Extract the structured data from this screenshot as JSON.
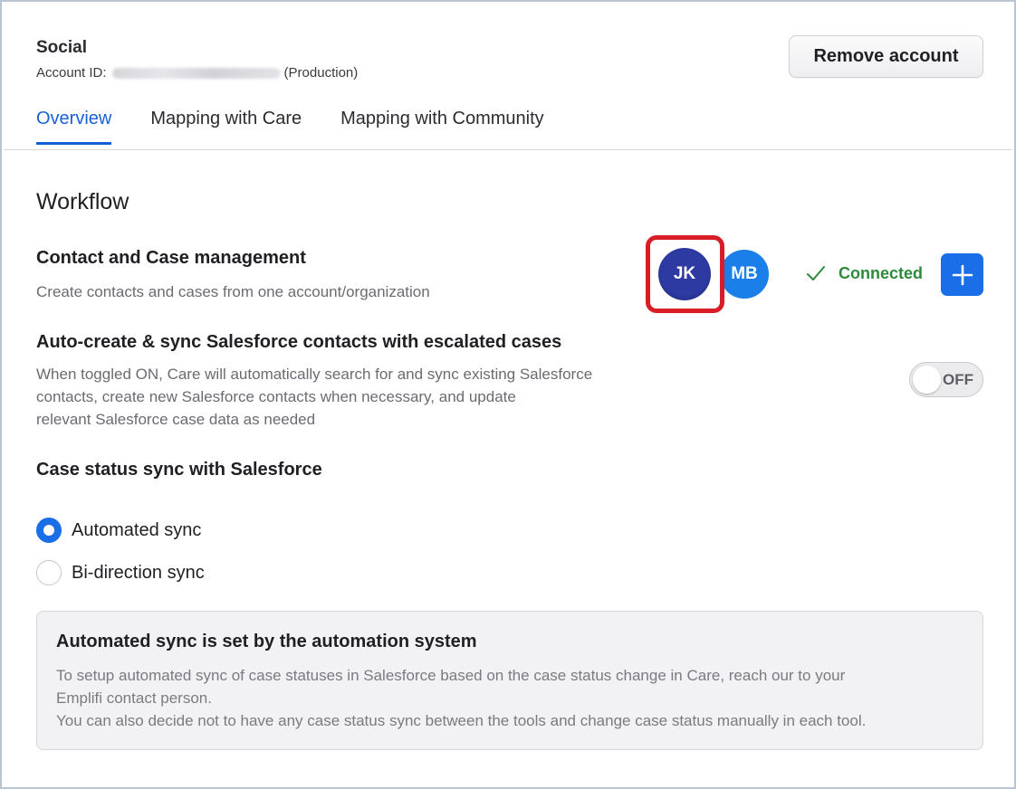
{
  "account": {
    "title": "Social",
    "id_label": "Account ID:",
    "environment": "(Production)",
    "remove_label": "Remove account"
  },
  "tabs": [
    {
      "label": "Overview",
      "active": true
    },
    {
      "label": "Mapping with Care",
      "active": false
    },
    {
      "label": "Mapping with Community",
      "active": false
    }
  ],
  "workflow": {
    "title": "Workflow",
    "contact_case": {
      "title": "Contact and Case management",
      "description": "Create contacts and cases from one account/organization",
      "avatars": [
        {
          "initials": "JK",
          "color": "#2d3aa2"
        },
        {
          "initials": "MB",
          "color": "#1a7fe8"
        }
      ],
      "status": "Connected",
      "status_color": "#2d8a3a",
      "add_icon": "plus-icon"
    },
    "auto_create": {
      "title": "Auto-create & sync Salesforce contacts with escalated cases",
      "description_lines": [
        "When toggled ON, Care will automatically search for and sync existing Salesforce",
        "contacts, create new Salesforce contacts when necessary, and update",
        "relevant Salesforce case data as needed"
      ],
      "toggle_label": "OFF",
      "toggle_on": false
    },
    "case_status": {
      "title": "Case status sync with Salesforce",
      "options": [
        {
          "label": "Automated sync",
          "selected": true
        },
        {
          "label": "Bi-direction sync",
          "selected": false
        }
      ]
    },
    "info": {
      "title": "Automated sync is set by the automation system",
      "lines": [
        "To setup automated sync of case statuses in Salesforce based on the case status change in Care, reach our to your",
        "Emplifi contact person.",
        "You can also decide not to have any case status sync between the tools and change case status manually in each tool."
      ]
    }
  },
  "colors": {
    "accent": "#1660d6",
    "button_blue": "#1a6ee8",
    "highlight_red": "#d81d26"
  }
}
